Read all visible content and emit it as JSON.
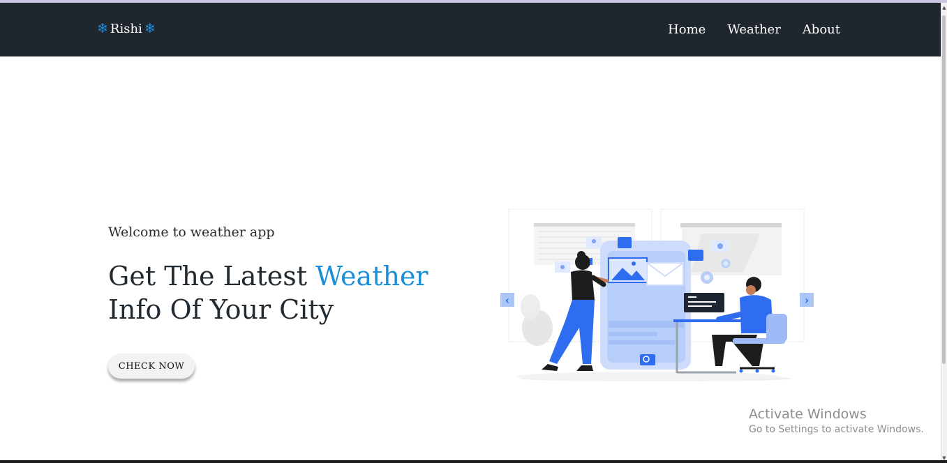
{
  "navbar": {
    "brand": "Rishi",
    "links": [
      "Home",
      "Weather",
      "About"
    ]
  },
  "hero": {
    "welcome": "Welcome to weather app",
    "headline_prefix": "Get The Latest ",
    "headline_accent": "Weather",
    "headline_suffix": " Info Of Your City",
    "cta": "CHECK NOW"
  },
  "carousel": {
    "prev_icon": "chevron-left-icon",
    "next_icon": "chevron-right-icon"
  },
  "watermark": {
    "title": "Activate Windows",
    "subtitle": "Go to Settings to activate Windows."
  },
  "colors": {
    "navbar_bg": "#1f262d",
    "accent": "#1a8fd8",
    "illustration_blue": "#2f6df0"
  }
}
